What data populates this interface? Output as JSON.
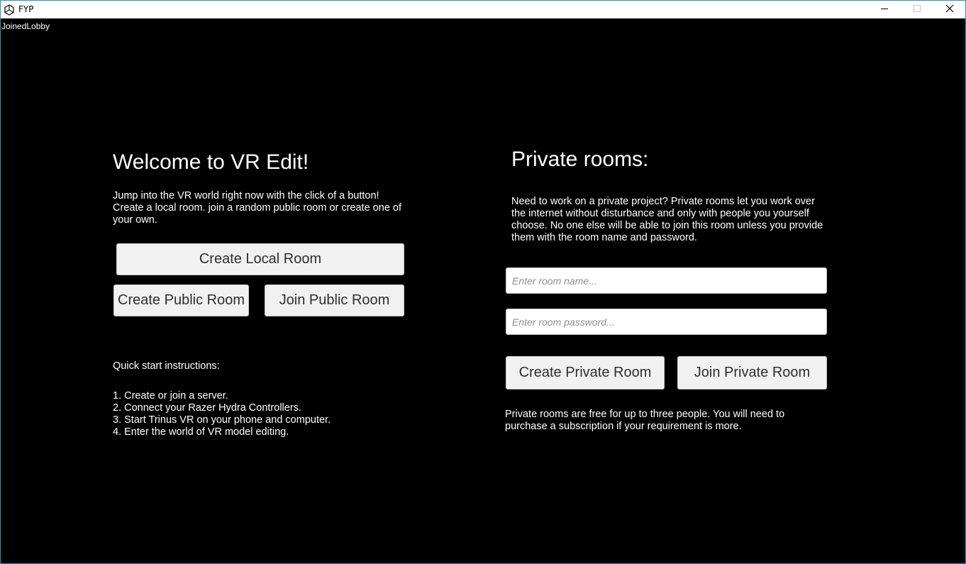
{
  "window": {
    "title": "FYP",
    "app_icon": "unity-icon",
    "controls": [
      "minimize-icon",
      "maximize-icon",
      "close-icon"
    ]
  },
  "status": "JoinedLobby",
  "welcome": {
    "title": "Welcome to VR Edit!",
    "description": "Jump into the VR world right now with the click of a button! Create a local room. join a random public room or create one of your own.",
    "create_local_label": "Create Local Room",
    "create_public_label": "Create Public Room",
    "join_public_label": "Join Public Room"
  },
  "instructions": {
    "title": "Quick start instructions:",
    "steps": [
      "1. Create or join a server.",
      "2. Connect your Razer Hydra Controllers.",
      "3. Start Trinus VR on your phone and computer.",
      "4. Enter the world of VR model editing."
    ]
  },
  "private": {
    "title": "Private rooms:",
    "description": "Need to work on a private project? Private rooms let you work over the internet without disturbance and only with people you yourself choose. No one else will be able to join this room unless you provide them with the room name and password.",
    "room_name_placeholder": "Enter room name...",
    "room_name_value": "",
    "room_password_placeholder": "Enter room password...",
    "room_password_value": "",
    "create_label": "Create Private Room",
    "join_label": "Join Private Room",
    "note": "Private rooms are free for up to three people. You will need to purchase a subscription if your requirement is more."
  }
}
